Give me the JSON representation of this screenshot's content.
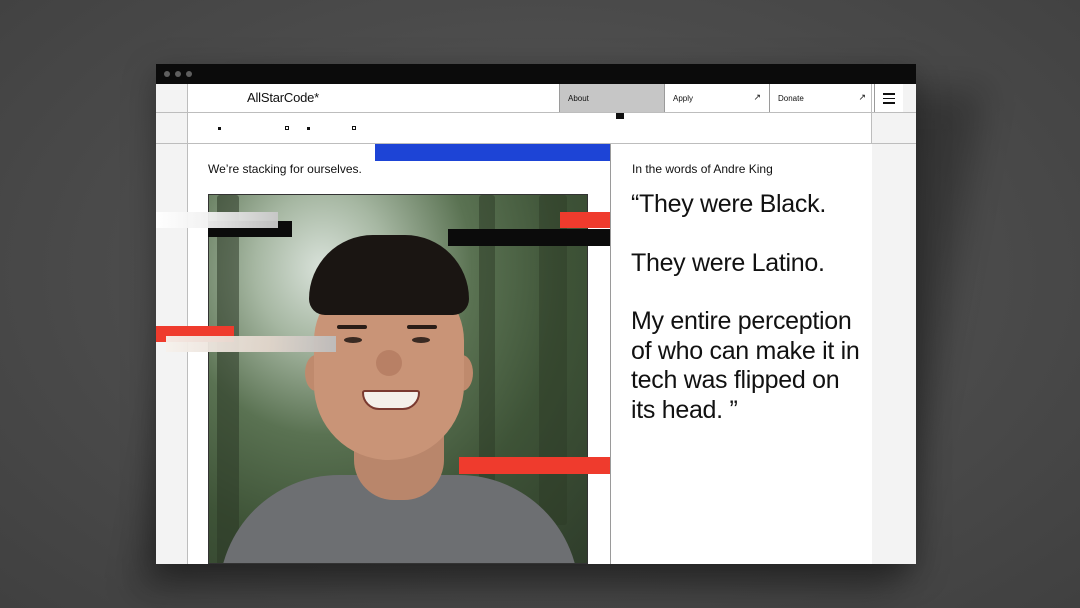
{
  "header": {
    "logo": "AllStarCode*",
    "nav": [
      {
        "label": "About",
        "arrow": ""
      },
      {
        "label": "Apply",
        "arrow": "↗"
      },
      {
        "label": "Donate",
        "arrow": "↗"
      }
    ],
    "menu_icon": "hamburger-menu-icon"
  },
  "main": {
    "tagline": "We’re stacking for ourselves.",
    "quote_author": "In the words of Andre King",
    "quote_paragraphs": [
      "“They were Black.",
      "They were Latino.",
      "My entire perception of who can make it in tech was flipped on its head. ”"
    ]
  },
  "colors": {
    "accent_blue": "#1d44d6",
    "accent_red": "#ef3b2d",
    "nav_active_bg": "#c6c6c6",
    "page_bg": "#f3f3f3"
  }
}
